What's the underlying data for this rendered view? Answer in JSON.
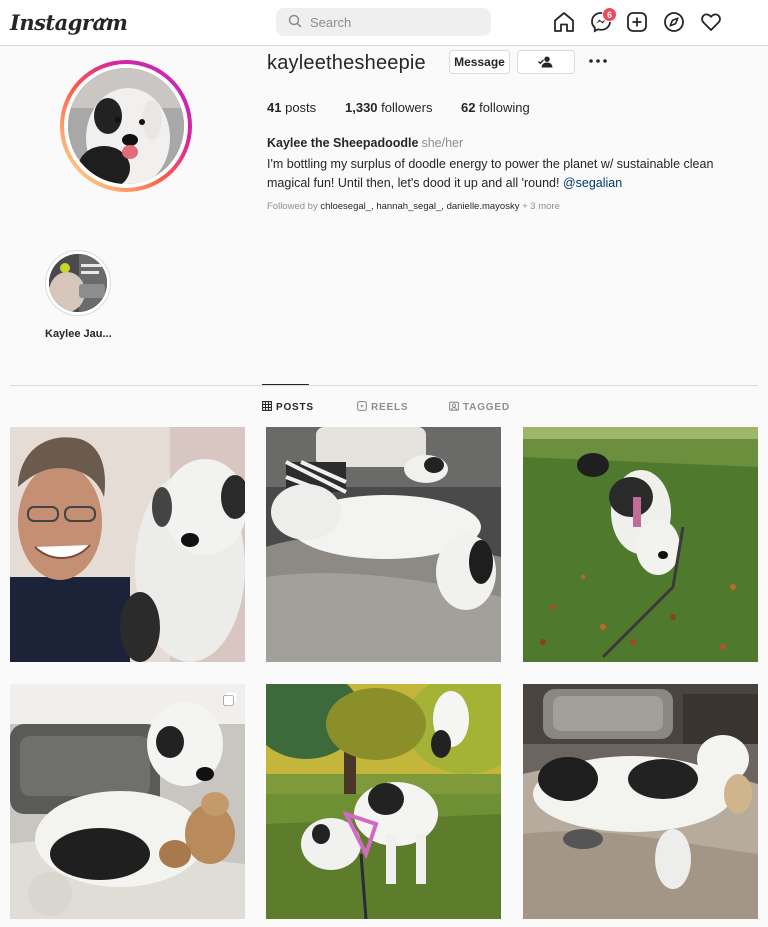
{
  "nav": {
    "logo": "Instagram",
    "search_placeholder": "Search",
    "messenger_badge": "6"
  },
  "profile": {
    "username": "kayleethesheepie",
    "message_label": "Message",
    "stats": {
      "posts_count": "41",
      "posts_label": "posts",
      "followers_count": "1,330",
      "followers_label": "followers",
      "following_count": "62",
      "following_label": "following"
    },
    "full_name": "Kaylee the Sheepadoodle",
    "pronouns": "she/her",
    "bio_text": "I'm bottling my surplus of doodle energy to power the planet w/ sustainable clean magical fun! Until then, let's dood it up and all 'round!",
    "bio_mention": "@segalian",
    "followed_by_prefix": "Followed by",
    "followed_by_names": "chloesegal_, hannah_segal_, danielle.mayosky",
    "followed_by_more": "+ 3 more"
  },
  "highlights": [
    {
      "label": "Kaylee Jau..."
    }
  ],
  "tabs": [
    {
      "label": "POSTS",
      "active": true
    },
    {
      "label": "REELS",
      "active": false
    },
    {
      "label": "TAGGED",
      "active": false
    }
  ],
  "posts": [
    {
      "description": "man-with-dog-selfie"
    },
    {
      "description": "dog-sleeping-on-bed"
    },
    {
      "description": "dog-walking-on-grass"
    },
    {
      "description": "dog-on-blanket-with-toy",
      "multiple": true
    },
    {
      "description": "dog-in-park"
    },
    {
      "description": "dog-lying-on-bed"
    }
  ],
  "colors": {
    "accent_blue": "#00376b",
    "badge_red": "#ed4956",
    "border": "#dbdbdb",
    "muted": "#8e8e8e"
  }
}
